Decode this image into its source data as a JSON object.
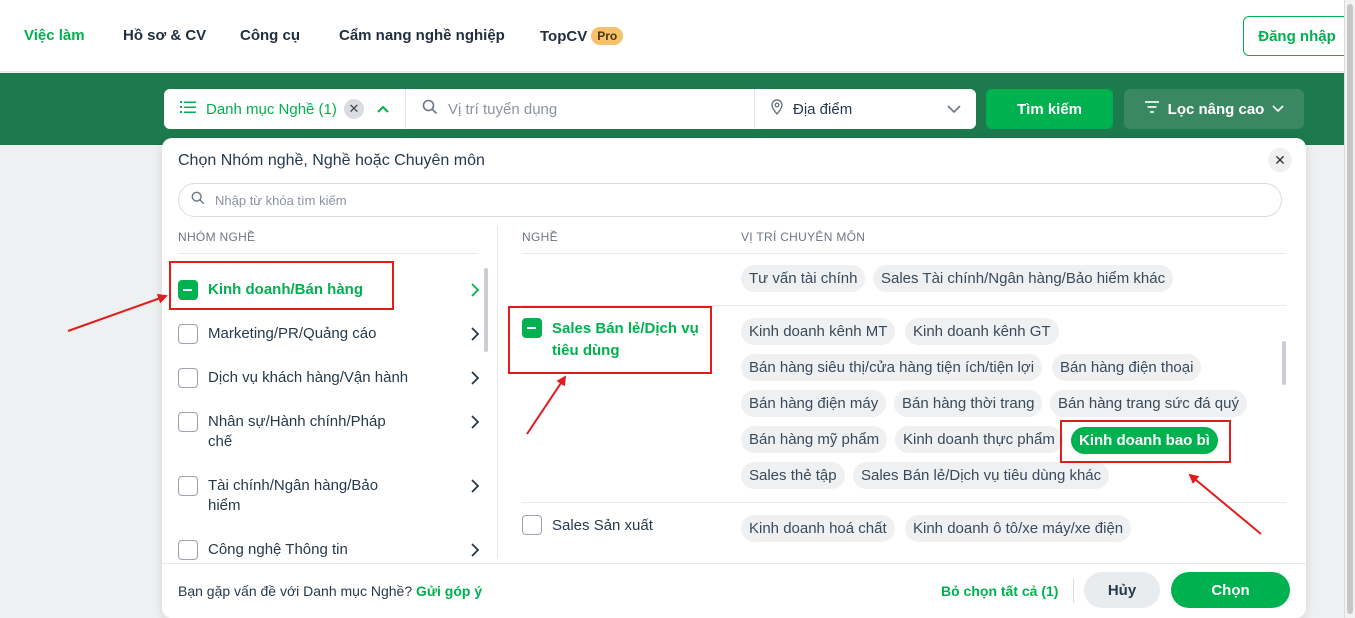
{
  "nav": {
    "items": [
      "Việc làm",
      "Hồ sơ & CV",
      "Công cụ",
      "Cẩm nang nghề nghiệp",
      "TopCV"
    ],
    "pro_badge": "Pro",
    "login": "Đăng nhập"
  },
  "search": {
    "category_label": "Danh mục Nghề (1)",
    "position_placeholder": "Vị trí tuyển dụng",
    "location_label": "Địa điểm",
    "search_button": "Tìm kiếm",
    "advanced_filter": "Lọc nâng cao"
  },
  "panel": {
    "title": "Chọn Nhóm nghề, Nghề hoặc Chuyên môn",
    "keyword_placeholder": "Nhập từ khóa tìm kiếm",
    "col_groups": "NHÓM NGHỀ",
    "col_professions": "NGHỀ",
    "col_positions": "VỊ TRÍ CHUYÊN MÔN",
    "groups": [
      "Kinh doanh/Bán hàng",
      "Marketing/PR/Quảng cáo",
      "Dịch vụ khách hàng/Vận hành",
      "Nhân sự/Hành chính/Pháp chế",
      "Tài chính/Ngân hàng/Bảo hiểm",
      "Công nghệ Thông tin"
    ],
    "professions": [
      "Sales Bán lẻ/Dịch vụ tiêu dùng",
      "Sales Sản xuất"
    ],
    "chips_prev": [
      "Tư vấn tài chính",
      "Sales Tài chính/Ngân hàng/Bảo hiểm khác"
    ],
    "chips_retail": [
      "Kinh doanh kênh MT",
      "Kinh doanh kênh GT",
      "Bán hàng siêu thị/cửa hàng tiện ích/tiện lợi",
      "Bán hàng điện thoại",
      "Bán hàng điện máy",
      "Bán hàng thời trang",
      "Bán hàng trang sức đá quý",
      "Bán hàng mỹ phẩm",
      "Kinh doanh thực phẩm",
      "Kinh doanh bao bì",
      "Sales thẻ tập",
      "Sales Bán lẻ/Dịch vụ tiêu dùng khác"
    ],
    "chips_manufacturing": [
      "Kinh doanh hoá chất",
      "Kinh doanh ô tô/xe máy/xe điện"
    ]
  },
  "footer": {
    "feedback_text": "Bạn gặp vấn đề với Danh mục Nghề?",
    "feedback_link": "Gửi góp ý",
    "deselect_all": "Bỏ chọn tất cả (1)",
    "cancel": "Hủy",
    "choose": "Chọn"
  },
  "colors": {
    "brand_green": "#00b14f",
    "header_green": "#1d7a4d",
    "annotation_red": "#e21b1b"
  }
}
